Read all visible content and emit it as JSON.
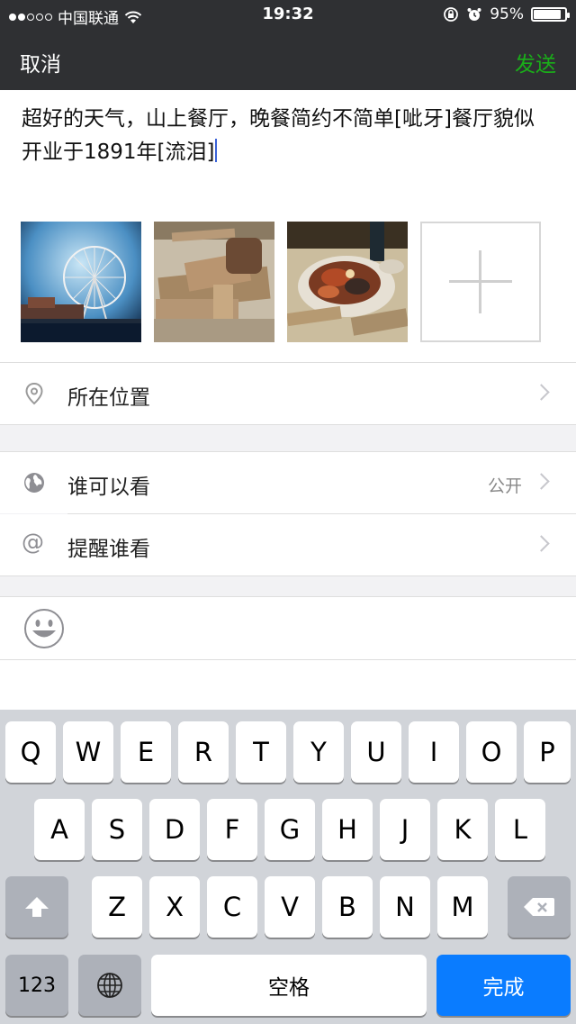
{
  "status_bar": {
    "carrier": "中国联通",
    "time": "19:32",
    "battery_percent": "95%",
    "battery_level": 0.95
  },
  "nav": {
    "cancel_label": "取消",
    "send_label": "发送"
  },
  "compose": {
    "text": "超好的天气，山上餐厅，晚餐简约不简单[呲牙]餐厅貌似开业于1891年[流泪]",
    "photos": [
      "ferris-wheel-photo",
      "wooden-platters-photo",
      "seafood-dish-photo"
    ]
  },
  "rows": {
    "location_label": "所在位置",
    "visibility_label": "谁可以看",
    "visibility_value": "公开",
    "mention_label": "提醒谁看"
  },
  "keyboard": {
    "row1": [
      "Q",
      "W",
      "E",
      "R",
      "T",
      "Y",
      "U",
      "I",
      "O",
      "P"
    ],
    "row2": [
      "A",
      "S",
      "D",
      "F",
      "G",
      "H",
      "J",
      "K",
      "L"
    ],
    "row3": [
      "Z",
      "X",
      "C",
      "V",
      "B",
      "N",
      "M"
    ],
    "numbers_label": "123",
    "space_label": "空格",
    "done_label": "完成"
  },
  "colors": {
    "send": "#1aad19",
    "done_key": "#0a7cff",
    "nav_bg": "#2f3033"
  }
}
